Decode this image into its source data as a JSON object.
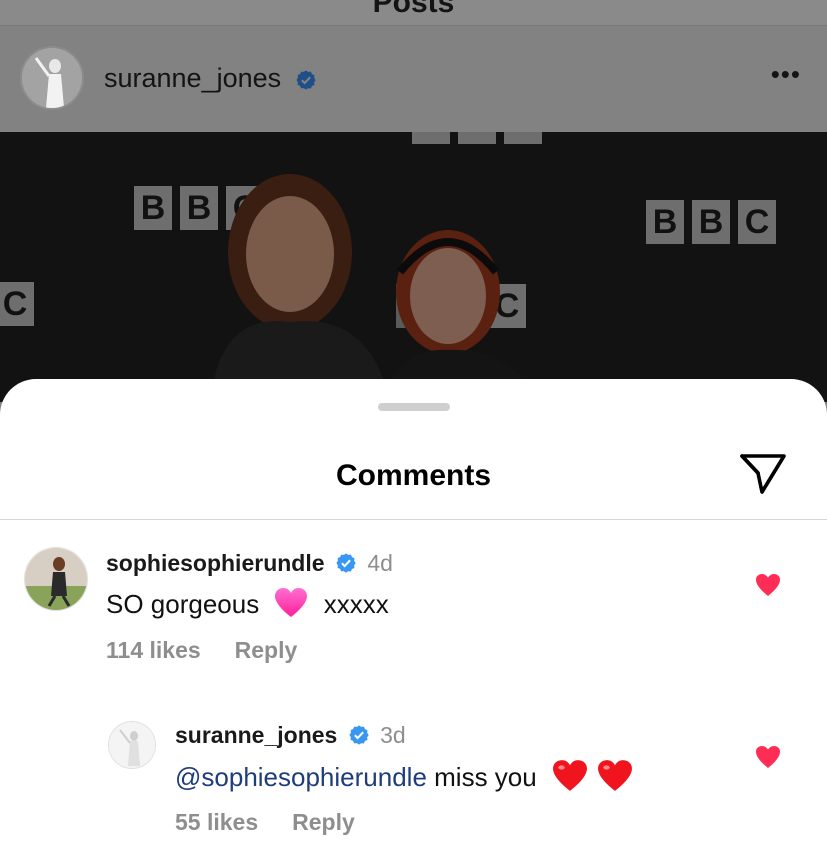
{
  "topbar": {
    "title": "Posts"
  },
  "post": {
    "username": "suranne_jones",
    "more_icon": "more-horizontal-icon",
    "photo_letters": [
      "B",
      "B",
      "C"
    ]
  },
  "comments_sheet": {
    "title": "Comments",
    "share_icon": "send-icon",
    "comments": [
      {
        "username": "sophiesophierundle",
        "time": "4d",
        "text_before": "SO gorgeous",
        "emoji": "pink-heart",
        "text_after": "xxxxx",
        "likes": "114 likes",
        "reply": "Reply"
      },
      {
        "username": "suranne_jones",
        "time": "3d",
        "mention": "@sophiesophierundle",
        "text": " miss you",
        "emoji": "red-heart-x2",
        "likes": "55 likes",
        "reply": "Reply"
      }
    ]
  },
  "colors": {
    "verified": "#3897f0",
    "like_red": "#ff2d55",
    "mention": "#1f3d7a",
    "meta_gray": "#8e8e8e"
  }
}
